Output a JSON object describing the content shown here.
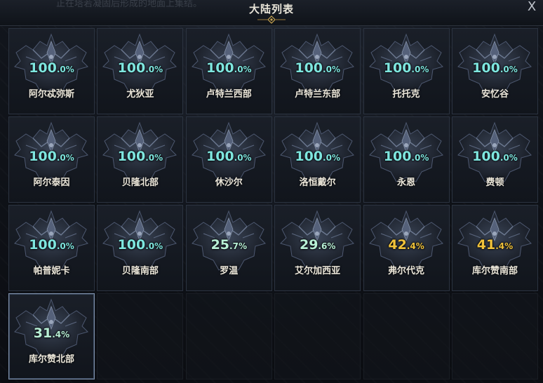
{
  "window": {
    "title": "大陆列表",
    "header_bg_text": "正在塔若凝固后形成的地面上集结。",
    "close_label": "X"
  },
  "colors": {
    "full": "#7ee6df",
    "partial_green": "#b8f0d6",
    "partial_gold": "#f0c23a",
    "name": "#ece7da"
  },
  "continents": [
    {
      "name": "阿尔忒弥斯",
      "pct_int": "100",
      "pct_dec": ".0%",
      "tone": "full",
      "selected": false
    },
    {
      "name": "尤狄亚",
      "pct_int": "100",
      "pct_dec": ".0%",
      "tone": "full",
      "selected": false
    },
    {
      "name": "卢特兰西部",
      "pct_int": "100",
      "pct_dec": ".0%",
      "tone": "full",
      "selected": false
    },
    {
      "name": "卢特兰东部",
      "pct_int": "100",
      "pct_dec": ".0%",
      "tone": "full",
      "selected": false
    },
    {
      "name": "托托克",
      "pct_int": "100",
      "pct_dec": ".0%",
      "tone": "full",
      "selected": false
    },
    {
      "name": "安忆谷",
      "pct_int": "100",
      "pct_dec": ".0%",
      "tone": "full",
      "selected": false
    },
    {
      "name": "阿尔泰因",
      "pct_int": "100",
      "pct_dec": ".0%",
      "tone": "full",
      "selected": false
    },
    {
      "name": "贝隆北部",
      "pct_int": "100",
      "pct_dec": ".0%",
      "tone": "full",
      "selected": false
    },
    {
      "name": "休沙尔",
      "pct_int": "100",
      "pct_dec": ".0%",
      "tone": "full",
      "selected": false
    },
    {
      "name": "洛恒戴尔",
      "pct_int": "100",
      "pct_dec": ".0%",
      "tone": "full",
      "selected": false
    },
    {
      "name": "永恩",
      "pct_int": "100",
      "pct_dec": ".0%",
      "tone": "full",
      "selected": false
    },
    {
      "name": "费顿",
      "pct_int": "100",
      "pct_dec": ".0%",
      "tone": "full",
      "selected": false
    },
    {
      "name": "帕普妮卡",
      "pct_int": "100",
      "pct_dec": ".0%",
      "tone": "full",
      "selected": false
    },
    {
      "name": "贝隆南部",
      "pct_int": "100",
      "pct_dec": ".0%",
      "tone": "full",
      "selected": false
    },
    {
      "name": "罗温",
      "pct_int": "25",
      "pct_dec": ".7%",
      "tone": "partial_green",
      "selected": false
    },
    {
      "name": "艾尔加西亚",
      "pct_int": "29",
      "pct_dec": ".6%",
      "tone": "partial_green",
      "selected": false
    },
    {
      "name": "弗尔代克",
      "pct_int": "42",
      "pct_dec": ".4%",
      "tone": "partial_gold",
      "selected": false
    },
    {
      "name": "库尔赞南部",
      "pct_int": "41",
      "pct_dec": ".4%",
      "tone": "partial_gold",
      "selected": false
    },
    {
      "name": "库尔赞北部",
      "pct_int": "31",
      "pct_dec": ".4%",
      "tone": "partial_green",
      "selected": true
    }
  ]
}
